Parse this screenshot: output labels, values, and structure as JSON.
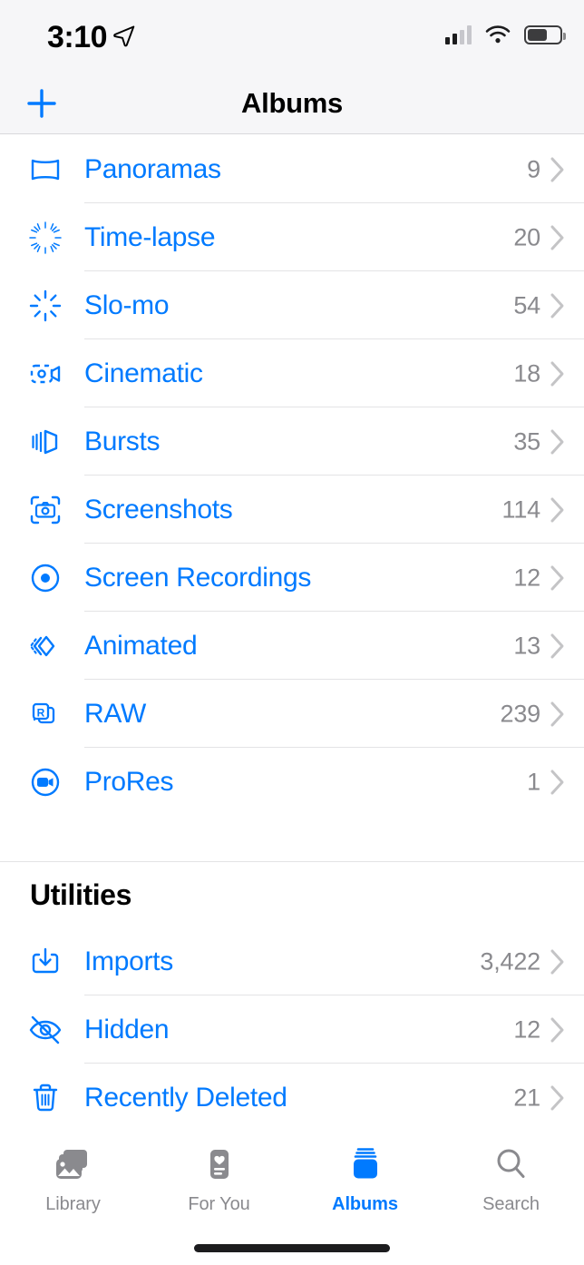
{
  "status_bar": {
    "time": "3:10",
    "location_icon": "location-arrow-icon",
    "signal_bars_filled": 2,
    "signal_bars_total": 4,
    "wifi_icon": "wifi-icon",
    "battery_percent": 55
  },
  "nav": {
    "title": "Albums",
    "add_label": "+"
  },
  "media_types": {
    "rows": [
      {
        "label": "Panoramas",
        "count": "9",
        "icon": "panorama-icon"
      },
      {
        "label": "Time-lapse",
        "count": "20",
        "icon": "timelapse-icon"
      },
      {
        "label": "Slo-mo",
        "count": "54",
        "icon": "slomo-icon"
      },
      {
        "label": "Cinematic",
        "count": "18",
        "icon": "cinematic-icon"
      },
      {
        "label": "Bursts",
        "count": "35",
        "icon": "bursts-icon"
      },
      {
        "label": "Screenshots",
        "count": "114",
        "icon": "screenshots-icon"
      },
      {
        "label": "Screen Recordings",
        "count": "12",
        "icon": "screen-recordings-icon"
      },
      {
        "label": "Animated",
        "count": "13",
        "icon": "animated-icon"
      },
      {
        "label": "RAW",
        "count": "239",
        "icon": "raw-icon"
      },
      {
        "label": "ProRes",
        "count": "1",
        "icon": "prores-icon"
      }
    ]
  },
  "utilities": {
    "title": "Utilities",
    "rows": [
      {
        "label": "Imports",
        "count": "3,422",
        "icon": "import-icon"
      },
      {
        "label": "Hidden",
        "count": "12",
        "icon": "eye-slash-icon"
      },
      {
        "label": "Recently Deleted",
        "count": "21",
        "icon": "trash-icon"
      }
    ]
  },
  "tabbar": {
    "tabs": [
      {
        "label": "Library",
        "icon": "photo-stack-icon",
        "active": false
      },
      {
        "label": "For You",
        "icon": "heart-card-icon",
        "active": false
      },
      {
        "label": "Albums",
        "icon": "albums-stack-icon",
        "active": true
      },
      {
        "label": "Search",
        "icon": "search-icon",
        "active": false
      }
    ]
  },
  "colors": {
    "accent": "#007AFF",
    "secondary_text": "#8A8A8E",
    "separator": "#E3E3E5",
    "chrome_bg": "#F6F6F8"
  }
}
